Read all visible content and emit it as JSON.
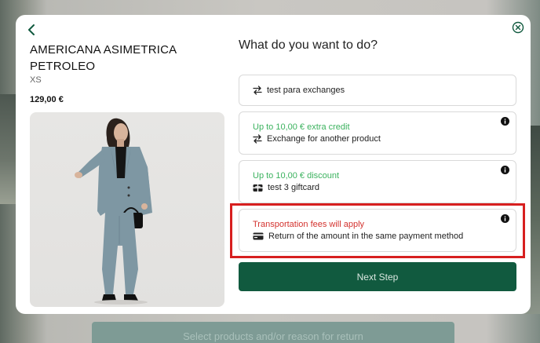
{
  "background": {
    "button_label": "Select products and/or reason for return"
  },
  "modal": {
    "back_icon": "chevron-left-icon",
    "close_icon": "close-circle-icon",
    "product": {
      "name": "AMERICANA ASIMETRICA PETROLEO",
      "size": "XS",
      "price": "129,00 €"
    },
    "question": "What do you want to do?",
    "options": [
      {
        "icon": "exchange-arrows-icon",
        "label": "test para exchanges"
      },
      {
        "note": "Up to 10,00 € extra credit",
        "note_color": "#3bb25e",
        "icon": "exchange-arrows-icon",
        "label": "Exchange for another product",
        "info_icon": "info-icon"
      },
      {
        "note": "Up to 10,00 € discount",
        "note_color": "#3bb25e",
        "icon": "gift-card-icon",
        "label": "test 3 giftcard",
        "info_icon": "info-icon"
      },
      {
        "note": "Transportation fees will apply",
        "note_color": "#d3322e",
        "icon": "credit-card-icon",
        "label": "Return of the amount in the same payment method",
        "info_icon": "info-icon",
        "highlighted": true
      }
    ],
    "next_step_label": "Next Step",
    "colors": {
      "primary": "#115a3f",
      "accent_green": "#3bb25e",
      "warning_red": "#d3322e",
      "highlight_border": "#d71f1f"
    }
  }
}
